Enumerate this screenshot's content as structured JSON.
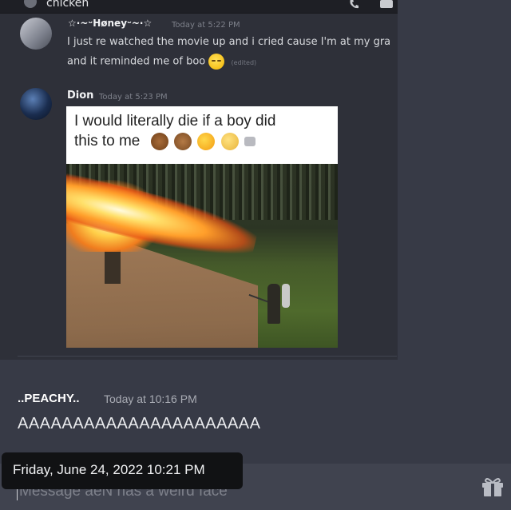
{
  "channel": {
    "name": "chicken"
  },
  "messages": [
    {
      "username": "☆·~ᵕHøneyᵕ~·☆",
      "timestamp": "Today at 5:22 PM",
      "line1": "I just re watched  the movie up and i cried cause I'm at my gra",
      "line2": "and it reminded me of boo",
      "edited": "(edited)"
    },
    {
      "username": "Dion",
      "timestamp": "Today at 5:23 PM",
      "meme_caption_line1": "I would literally die if a boy did",
      "meme_caption_line2": "this to me"
    },
    {
      "username": "..PEACHY..",
      "timestamp": "Today at 10:16 PM",
      "text": "AAAAAAAAAAAAAAAAAAAAAA"
    }
  ],
  "composer": {
    "placeholder": "Message aeN has a weird face"
  },
  "tooltip": {
    "text": "Friday, June 24, 2022 10:21 PM"
  },
  "icons": [
    "phone-icon",
    "video-icon",
    "gift-icon",
    "emoji-icon"
  ]
}
